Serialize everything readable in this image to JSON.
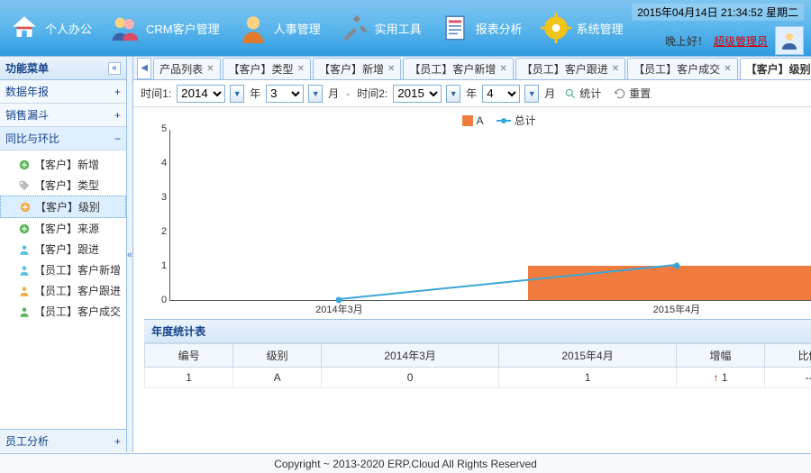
{
  "header": {
    "datetime": "2015年04月14日 21:34:52 星期二",
    "greeting": "晚上好！",
    "user": "超级管理员",
    "nav": [
      {
        "label": "个人办公",
        "icon": "home"
      },
      {
        "label": "CRM客户管理",
        "icon": "users"
      },
      {
        "label": "人事管理",
        "icon": "person"
      },
      {
        "label": "实用工具",
        "icon": "tools"
      },
      {
        "label": "报表分析",
        "icon": "report"
      },
      {
        "label": "系统管理",
        "icon": "gear"
      }
    ]
  },
  "sidebar": {
    "title": "功能菜单",
    "items": [
      {
        "label": "数据年报",
        "expanded": false
      },
      {
        "label": "销售漏斗",
        "expanded": false
      },
      {
        "label": "同比与环比",
        "expanded": true
      }
    ],
    "tree": [
      {
        "label": "【客户】新增",
        "icon": "green-plus"
      },
      {
        "label": "【客户】类型",
        "icon": "tag"
      },
      {
        "label": "【客户】级别",
        "icon": "orange-plus",
        "selected": true
      },
      {
        "label": "【客户】来源",
        "icon": "green-plus"
      },
      {
        "label": "【客户】跟进",
        "icon": "user-blue"
      },
      {
        "label": "【员工】客户新增",
        "icon": "user-blue"
      },
      {
        "label": "【员工】客户跟进",
        "icon": "user-orange"
      },
      {
        "label": "【员工】客户成交",
        "icon": "user-green"
      }
    ],
    "bottom": {
      "label": "员工分析"
    }
  },
  "tabs": {
    "items": [
      {
        "label": "产品列表"
      },
      {
        "label": "【客户】类型"
      },
      {
        "label": "【客户】新增"
      },
      {
        "label": "【员工】客户新增"
      },
      {
        "label": "【员工】客户跟进"
      },
      {
        "label": "【员工】客户成交"
      },
      {
        "label": "【客户】级别",
        "active": true
      }
    ]
  },
  "toolbar": {
    "time1_label": "时间1:",
    "time1_year": "2014",
    "year_unit": "年",
    "time1_month": "3",
    "month_unit": "月",
    "dash": "-",
    "time2_label": "时间2:",
    "time2_year": "2015",
    "time2_month": "4",
    "stats_btn": "统计",
    "reset_btn": "重置"
  },
  "chart_data": {
    "type": "bar+line",
    "categories": [
      "2014年3月",
      "2015年4月"
    ],
    "series": [
      {
        "name": "A",
        "kind": "bar",
        "values": [
          0,
          1
        ],
        "color": "#f07b3f"
      },
      {
        "name": "总计",
        "kind": "line",
        "values": [
          0,
          1
        ],
        "color": "#3aa6d8"
      }
    ],
    "ylim": [
      0,
      5
    ],
    "yticks": [
      0,
      1,
      2,
      3,
      4,
      5
    ]
  },
  "table": {
    "title": "年度统计表",
    "columns": [
      "编号",
      "级别",
      "2014年3月",
      "2015年4月",
      "增幅",
      "比例"
    ],
    "rows": [
      {
        "id": "1",
        "level": "A",
        "c1": "0",
        "c2": "1",
        "delta": "1",
        "delta_dir": "up",
        "ratio": "--"
      }
    ]
  },
  "footer": "Copyright ~ 2013-2020 ERP.Cloud All Rights Reserved"
}
